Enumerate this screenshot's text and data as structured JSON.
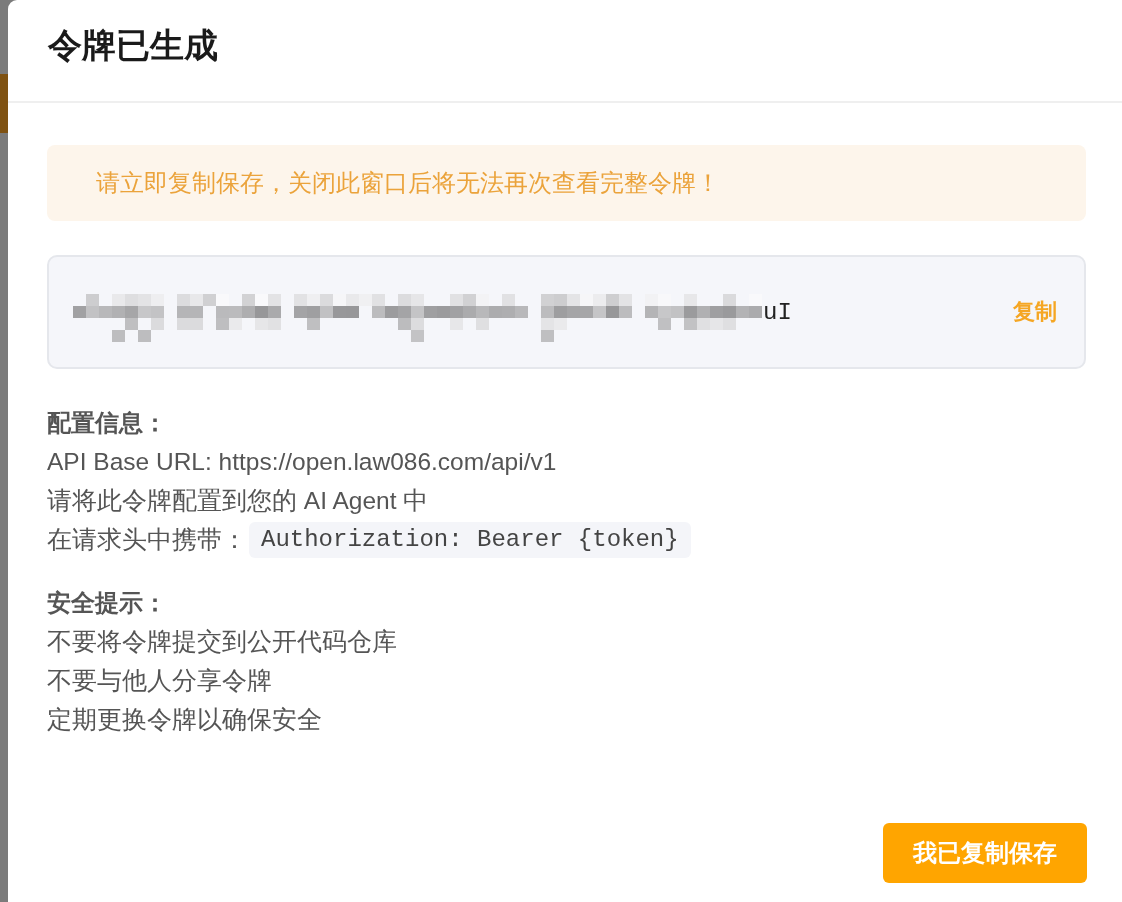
{
  "dialog": {
    "title": "令牌已生成"
  },
  "warning": {
    "text": "请立即复制保存，关闭此窗口后将无法再次查看完整令牌！"
  },
  "token": {
    "visible_text": "uI",
    "copy_label": "复制"
  },
  "sections": [
    {
      "heading": "配置信息：",
      "lines": [
        {
          "kind": "text",
          "text": "API Base URL: https://open.law086.com/api/v1"
        },
        {
          "kind": "text",
          "text": "请将此令牌配置到您的 AI Agent 中"
        },
        {
          "kind": "code",
          "text": "在请求头中携带：",
          "code": "Authorization: Bearer {token}"
        }
      ]
    },
    {
      "heading": "安全提示：",
      "lines": [
        {
          "kind": "text",
          "text": "不要将令牌提交到公开代码仓库"
        },
        {
          "kind": "text",
          "text": "不要与他人分享令牌"
        },
        {
          "kind": "text",
          "text": "定期更换令牌以确保安全"
        }
      ]
    }
  ],
  "confirm_button": "我已复制保存"
}
